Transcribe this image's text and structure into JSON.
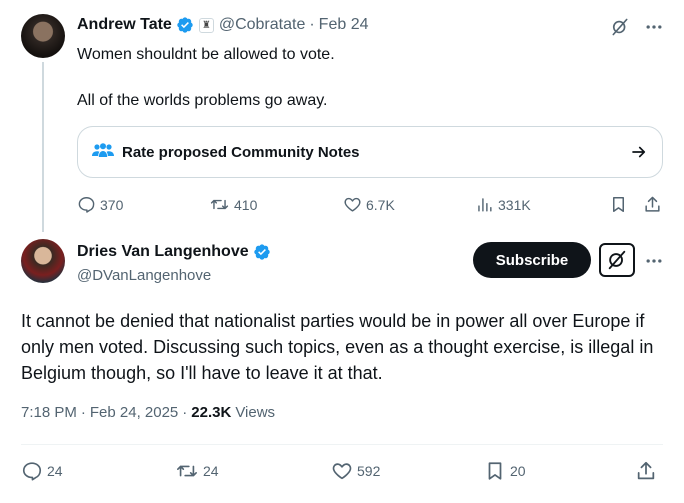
{
  "parent": {
    "name": "Andrew Tate",
    "handle": "@Cobratate",
    "date": "Feb 24",
    "text_line1": "Women shouldnt be allowed to vote.",
    "text_line2": "All of the worlds problems go away.",
    "community_notes_label": "Rate proposed Community Notes",
    "replies": "370",
    "reposts": "410",
    "likes": "6.7K",
    "views": "331K"
  },
  "main": {
    "name": "Dries Van Langenhove",
    "handle": "@DVanLangenhove",
    "subscribe_label": "Subscribe",
    "text": "It cannot be denied that nationalist parties would be in power all over Europe if only men voted. Discussing such topics, even as a thought exercise, is illegal in Belgium though, so I'll have to leave it at that.",
    "time": "7:18 PM",
    "date": "Feb 24, 2025",
    "views_count": "22.3K",
    "views_label": "Views",
    "replies": "24",
    "reposts": "24",
    "likes": "592",
    "bookmarks": "20"
  },
  "colors": {
    "text": "#0f1419",
    "muted": "#536471",
    "border": "#cfd9de",
    "verified": "#1d9bf0",
    "button": "#0f1419"
  }
}
